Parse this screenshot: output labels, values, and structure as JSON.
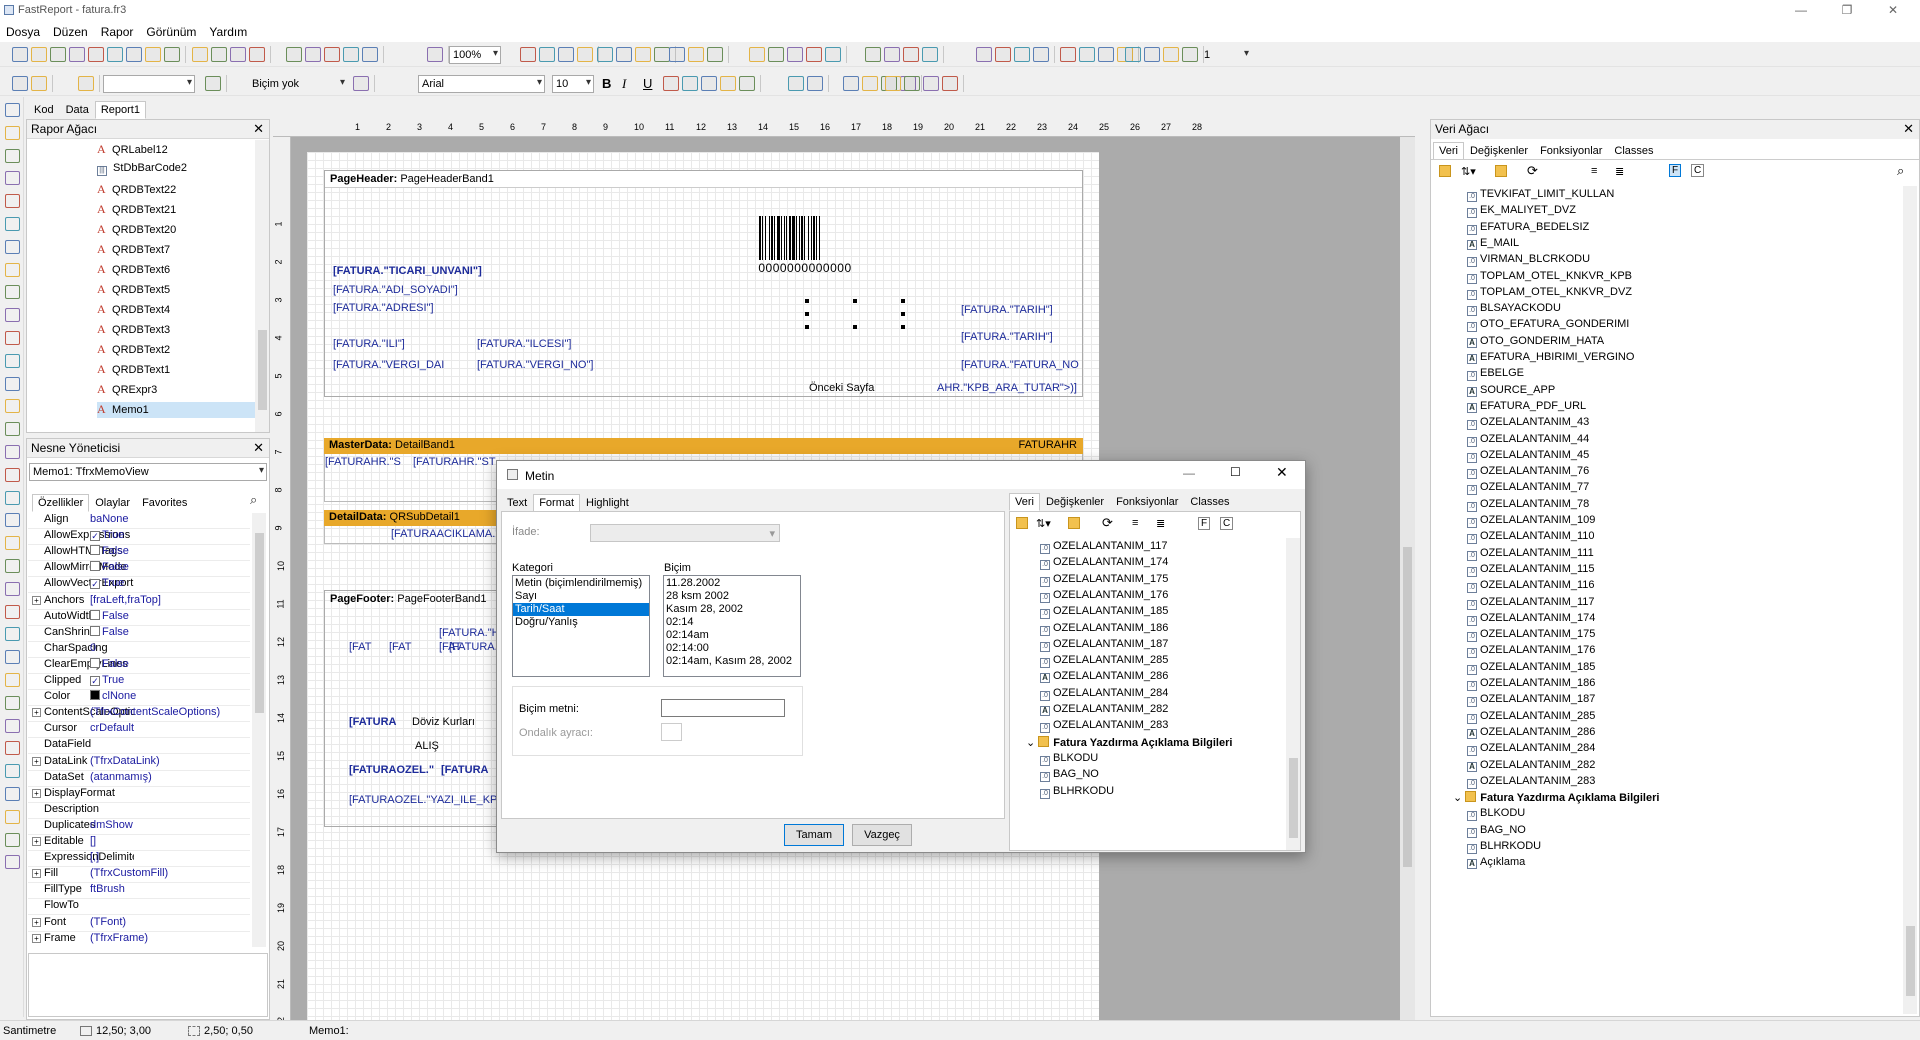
{
  "window": {
    "title": "FastReport - fatura.fr3"
  },
  "menu": [
    "Dosya",
    "Düzen",
    "Rapor",
    "Görünüm",
    "Yardım"
  ],
  "toolbar": {
    "zoom": "100%",
    "style": "Biçim yok",
    "font": "Arial",
    "font_size": "10",
    "frame_width": "1"
  },
  "doc_tabs": [
    "Kod",
    "Data",
    "Report1"
  ],
  "report_tree": {
    "title": "Rapor Ağacı",
    "items": [
      "QRLabel12",
      "StDbBarCode2",
      "QRDBText22",
      "QRDBText21",
      "QRDBText20",
      "QRDBText7",
      "QRDBText6",
      "QRDBText5",
      "QRDBText4",
      "QRDBText3",
      "QRDBText2",
      "QRDBText1",
      "QRExpr3",
      "Memo1"
    ]
  },
  "object_inspector": {
    "title": "Nesne Yöneticisi",
    "selected": "Memo1: TfrxMemoView",
    "tabs": [
      "Özellikler",
      "Olaylar",
      "Favorites"
    ],
    "props": [
      {
        "n": "Align",
        "v": "baNone"
      },
      {
        "n": "AllowExpressions",
        "v": "True",
        "chk": true
      },
      {
        "n": "AllowHTMLTags",
        "v": "False",
        "chk": false
      },
      {
        "n": "AllowMirrorMode",
        "v": "False",
        "chk": false
      },
      {
        "n": "AllowVectorExport",
        "v": "True",
        "chk": true
      },
      {
        "n": "Anchors",
        "v": "[fraLeft,fraTop]",
        "plus": true
      },
      {
        "n": "AutoWidth",
        "v": "False",
        "chk": false
      },
      {
        "n": "CanShrink",
        "v": "False",
        "chk": false
      },
      {
        "n": "CharSpacing",
        "v": "0"
      },
      {
        "n": "ClearEmptyLines",
        "v": "False",
        "chk": false
      },
      {
        "n": "Clipped",
        "v": "True",
        "chk": true
      },
      {
        "n": "Color",
        "v": "clNone",
        "swatch": true
      },
      {
        "n": "ContentScaleOptions",
        "v": "(TfrxContentScaleOptions)",
        "plus": true
      },
      {
        "n": "Cursor",
        "v": "crDefault"
      },
      {
        "n": "DataField",
        "v": ""
      },
      {
        "n": "DataLink",
        "v": "(TfrxDataLink)",
        "plus": true
      },
      {
        "n": "DataSet",
        "v": "(atanmamış)"
      },
      {
        "n": "DisplayFormat",
        "v": "",
        "plus": true
      },
      {
        "n": "Description",
        "v": ""
      },
      {
        "n": "Duplicates",
        "v": "dmShow"
      },
      {
        "n": "Editable",
        "v": "[]",
        "plus": true
      },
      {
        "n": "ExpressionDelimiters",
        "v": "[,]"
      },
      {
        "n": "Fill",
        "v": "(TfrxCustomFill)",
        "plus": true
      },
      {
        "n": "FillType",
        "v": "ftBrush"
      },
      {
        "n": "FlowTo",
        "v": ""
      },
      {
        "n": "Font",
        "v": "(TFont)",
        "plus": true
      },
      {
        "n": "Frame",
        "v": "(TfrxFrame)",
        "plus": true
      }
    ]
  },
  "bands": {
    "page_header": {
      "label": "PageHeader:",
      "name": "PageHeaderBand1"
    },
    "master": {
      "label": "MasterData:",
      "name": "DetailBand1",
      "dataset": "FATURAHR"
    },
    "detail": {
      "label": "DetailData:",
      "name": "QRSubDetail1"
    },
    "page_footer": {
      "label": "PageFooter:",
      "name": "PageFooterBand1"
    }
  },
  "header_objects": {
    "barcode_text": "0000000000000",
    "ticari": "[FATURA.\"TICARI_UNVANI\"]",
    "adi": "[FATURA.\"ADI_SOYADI\"]",
    "adres": "[FATURA.\"ADRESI\"]",
    "ili": "[FATURA.\"ILI\"]",
    "ilcesi": "[FATURA.\"ILCESI\"]",
    "vergi_dai": "[FATURA.\"VERGI_DAI",
    "vergi_no": "[FATURA.\"VERGI_NO\"]",
    "tarih1": "[FATURA.\"TARIH\"]",
    "tarih2": "[FATURA.\"TARIH\"]",
    "fatura_no": "[FATURA.\"FATURA_NO",
    "onceki": "Önceki Sayfa",
    "kpb": "AHR.\"KPB_ARA_TUTAR\">)]"
  },
  "master_objects": {
    "a": "[FATURAHR.\"S",
    "b": "[FATURAHR.\"ST"
  },
  "detail_objects": {
    "a": "[FATURAACIKLAMA.\"A"
  },
  "footer_objects": {
    "f1": "[FAT",
    "f2": "[FAT",
    "f3": "[FAT",
    "f4": "[FATURA.\"H",
    "f5": "[FATURA.\"H",
    "fatura": "[FATURA",
    "doviz": "Döviz Kurları",
    "alis": "ALIŞ",
    "ozel1": "[FATURAOZEL.\"",
    "ozel2": "[FATURA",
    "yazi": "[FATURAOZEL.\"YAZI_ILE_KPB"
  },
  "dialog": {
    "title": "Metin",
    "tabs": [
      "Text",
      "Format",
      "Highlight"
    ],
    "ifade_label": "İfade:",
    "kategori_label": "Kategori",
    "kategoriler": [
      "Metin (biçimlendirilmemiş)",
      "Sayı",
      "Tarih/Saat",
      "Doğru/Yanlış"
    ],
    "kategori_selected": 2,
    "bicim_label": "Biçim",
    "bicimler": [
      "11.28.2002",
      "28 ksm 2002",
      "Kasım 28, 2002",
      "02:14",
      "02:14am",
      "02:14:00",
      "02:14am, Kasım 28, 2002"
    ],
    "bicim_metni_label": "Biçim metni:",
    "ondalik_label": "Ondalık ayracı:",
    "ok": "Tamam",
    "cancel": "Vazgeç",
    "tree_tabs": [
      "Veri",
      "Değişkenler",
      "Fonksiyonlar",
      "Classes"
    ],
    "tree_items": [
      {
        "t": "OZELALANTANIM_117"
      },
      {
        "t": "OZELALANTANIM_174"
      },
      {
        "t": "OZELALANTANIM_175"
      },
      {
        "t": "OZELALANTANIM_176"
      },
      {
        "t": "OZELALANTANIM_185"
      },
      {
        "t": "OZELALANTANIM_186"
      },
      {
        "t": "OZELALANTANIM_187"
      },
      {
        "t": "OZELALANTANIM_285"
      },
      {
        "t": "OZELALANTANIM_286",
        "a": true
      },
      {
        "t": "OZELALANTANIM_284"
      },
      {
        "t": "OZELALANTANIM_282",
        "a": true
      },
      {
        "t": "OZELALANTANIM_283"
      },
      {
        "t": "Fatura Yazdırma Açıklama Bilgileri",
        "group": true
      },
      {
        "t": "BLKODU"
      },
      {
        "t": "BAG_NO"
      },
      {
        "t": "BLHRKODU"
      }
    ]
  },
  "data_tree": {
    "title": "Veri Ağacı",
    "tabs": [
      "Veri",
      "Değişkenler",
      "Fonksiyonlar",
      "Classes"
    ],
    "items": [
      {
        "t": "TEVKIFAT_LIMIT_KULLAN"
      },
      {
        "t": "EK_MALIYET_DVZ"
      },
      {
        "t": "EFATURA_BEDELSIZ"
      },
      {
        "t": "E_MAIL",
        "a": true
      },
      {
        "t": "VIRMAN_BLCRKODU"
      },
      {
        "t": "TOPLAM_OTEL_KNKVR_KPB"
      },
      {
        "t": "TOPLAM_OTEL_KNKVR_DVZ"
      },
      {
        "t": "BLSAYACKODU"
      },
      {
        "t": "OTO_EFATURA_GONDERIMI"
      },
      {
        "t": "OTO_GONDERIM_HATA",
        "a": true
      },
      {
        "t": "EFATURA_HBIRIMI_VERGINO",
        "a": true
      },
      {
        "t": "EBELGE"
      },
      {
        "t": "SOURCE_APP",
        "a": true
      },
      {
        "t": "EFATURA_PDF_URL",
        "a": true
      },
      {
        "t": "OZELALANTANIM_43"
      },
      {
        "t": "OZELALANTANIM_44"
      },
      {
        "t": "OZELALANTANIM_45"
      },
      {
        "t": "OZELALANTANIM_76"
      },
      {
        "t": "OZELALANTANIM_77"
      },
      {
        "t": "OZELALANTANIM_78"
      },
      {
        "t": "OZELALANTANIM_109"
      },
      {
        "t": "OZELALANTANIM_110"
      },
      {
        "t": "OZELALANTANIM_111"
      },
      {
        "t": "OZELALANTANIM_115"
      },
      {
        "t": "OZELALANTANIM_116"
      },
      {
        "t": "OZELALANTANIM_117"
      },
      {
        "t": "OZELALANTANIM_174"
      },
      {
        "t": "OZELALANTANIM_175"
      },
      {
        "t": "OZELALANTANIM_176"
      },
      {
        "t": "OZELALANTANIM_185"
      },
      {
        "t": "OZELALANTANIM_186"
      },
      {
        "t": "OZELALANTANIM_187"
      },
      {
        "t": "OZELALANTANIM_285"
      },
      {
        "t": "OZELALANTANIM_286",
        "a": true
      },
      {
        "t": "OZELALANTANIM_284"
      },
      {
        "t": "OZELALANTANIM_282",
        "a": true
      },
      {
        "t": "OZELALANTANIM_283"
      },
      {
        "t": "Fatura Yazdırma Açıklama Bilgileri",
        "group": true
      },
      {
        "t": "BLKODU"
      },
      {
        "t": "BAG_NO"
      },
      {
        "t": "BLHRKODU"
      },
      {
        "t": "Açıklama",
        "a": true
      }
    ]
  },
  "status": {
    "unit": "Santimetre",
    "pos": "12,50; 3,00",
    "size": "2,50; 0,50",
    "object": "Memo1:"
  },
  "colors": {
    "band_accent": "#e8a82a",
    "selection": "#0078d7",
    "field_text": "#1d2b9a"
  }
}
